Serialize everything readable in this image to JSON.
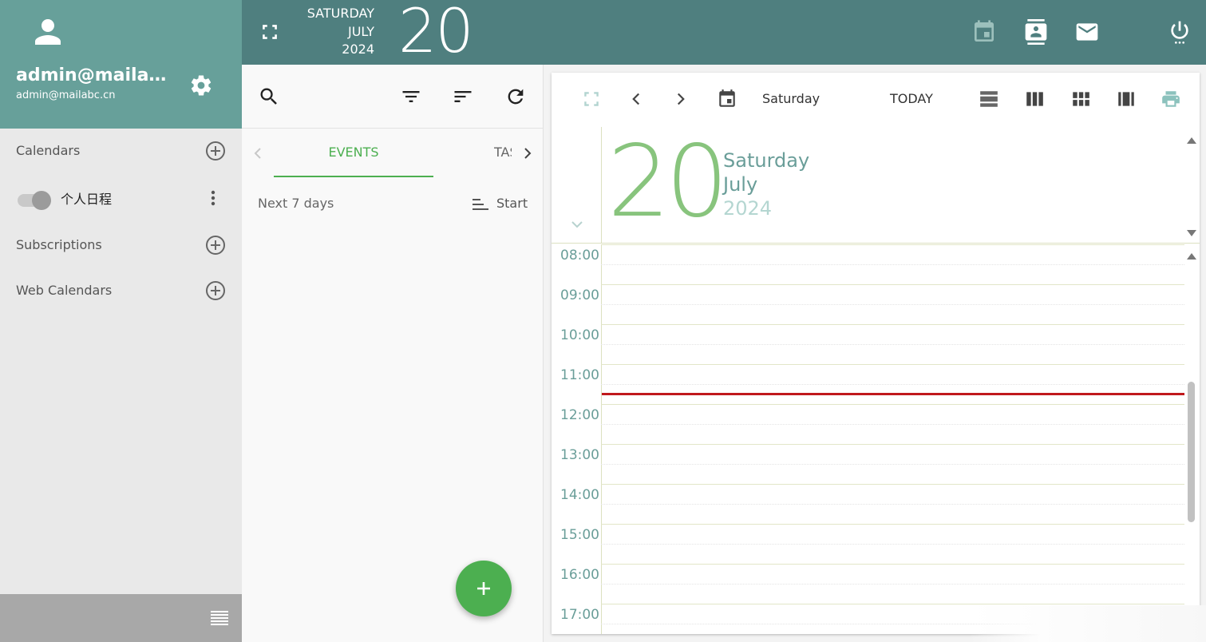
{
  "app": {
    "accent": "#4caf50",
    "header_color": "#4f7f7f",
    "profile_color": "#67a09a"
  },
  "profile": {
    "name": "admin@mailab...",
    "email": "admin@mailabc.cn"
  },
  "sidebar": {
    "calendars_label": "Calendars",
    "calendar_items": [
      {
        "name": "个人日程",
        "enabled": true
      }
    ],
    "subscriptions_label": "Subscriptions",
    "web_calendars_label": "Web Calendars"
  },
  "header": {
    "weekday": "SATURDAY",
    "month": "JULY",
    "year": "2024",
    "day": "20",
    "icons": [
      "calendar-icon",
      "contacts-icon",
      "mail-icon",
      "power-icon"
    ]
  },
  "list_panel": {
    "tabs": {
      "events": "EVENTS",
      "tasks": "TASKS"
    },
    "range_label": "Next 7 days",
    "sort_label": "Start",
    "fab_label": "+"
  },
  "calendar": {
    "toolbar_day": "Saturday",
    "today_label": "TODAY",
    "day_header": {
      "day": "20",
      "weekday": "Saturday",
      "month": "July",
      "year": "2024"
    },
    "hours": [
      "08:00",
      "09:00",
      "10:00",
      "11:00",
      "12:00",
      "13:00",
      "14:00",
      "15:00",
      "16:00",
      "17:00"
    ],
    "current_time_line_color": "#c0181c"
  }
}
